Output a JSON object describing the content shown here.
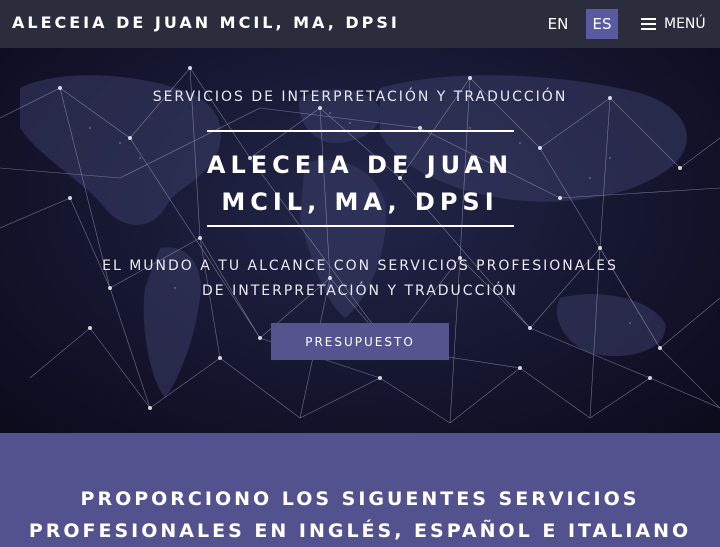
{
  "header": {
    "brand": "ALECEIA DE JUAN MCIL, MA, DPSI",
    "lang_en": "EN",
    "lang_es": "ES",
    "menu_label": "MENÚ"
  },
  "hero": {
    "subtitle": "SERVICIOS DE INTERPRETACIÓN Y TRADUCCIÓN",
    "title_line1": "ALECEIA DE JUAN",
    "title_line2": "MCIL, MA, DPSI",
    "tagline_line1": "EL MUNDO A TU ALCANCE CON SERVICIOS PROFESIONALES",
    "tagline_line2": "DE INTERPRETACIÓN Y TRADUCCIÓN",
    "cta_label": "PRESUPUESTO"
  },
  "services": {
    "title_line1": "PROPORCIONO LOS SIGUENTES SERVICIOS",
    "title_line2": "PROFESIONALES EN INGLÉS, ESPAÑOL E ITALIANO"
  },
  "colors": {
    "navbar": "#2b2d3d",
    "accent": "#5a5aa0",
    "services_band": "#53528f"
  }
}
